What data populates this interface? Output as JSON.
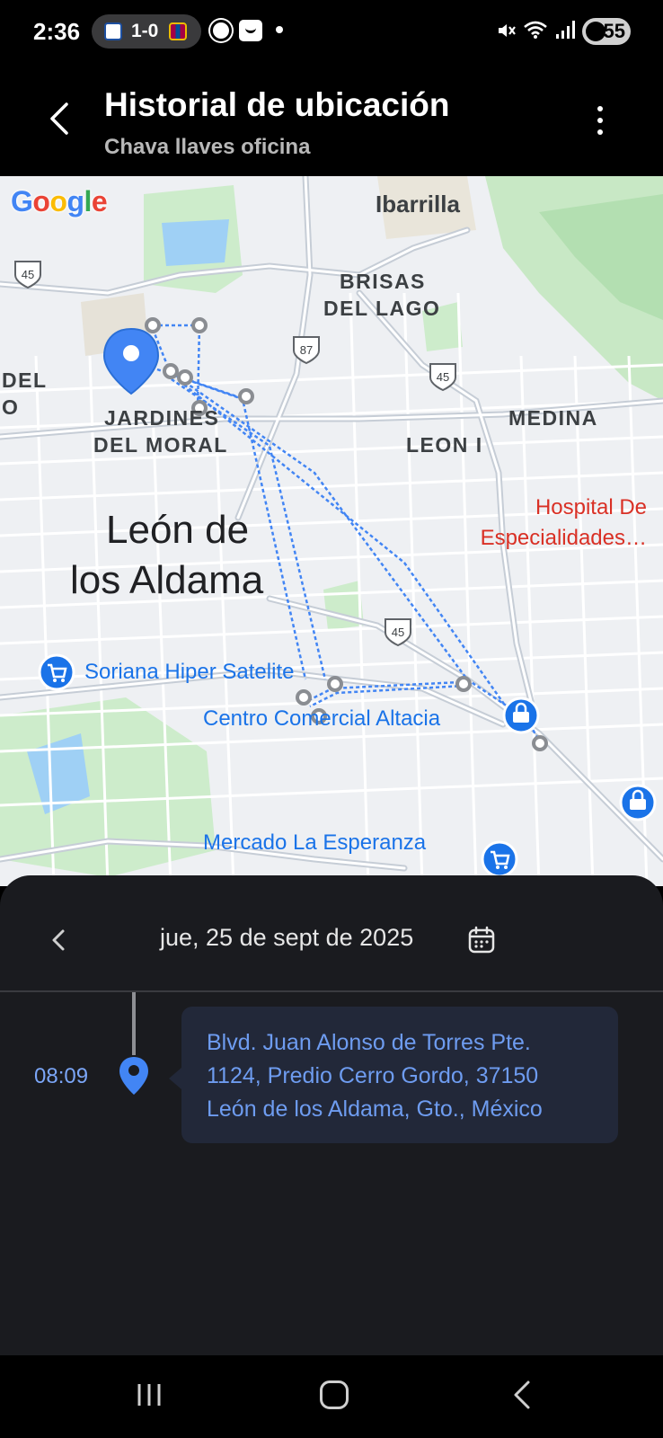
{
  "status_bar": {
    "time": "2:36",
    "score": "1-0",
    "battery": "55"
  },
  "app_bar": {
    "title": "Historial de ubicación",
    "subtitle": "Chava llaves oficina"
  },
  "map": {
    "google_logo": "Google",
    "labels": {
      "ibarrilla": "Ibarrilla",
      "brisas_1": "BRISAS",
      "brisas_2": "DEL LAGO",
      "del_1": "DEL",
      "del_2": "O",
      "jardines_1": "JARDINES",
      "jardines_2": "DEL MORAL",
      "medina": "MEDINA",
      "leon_i": "LEON I",
      "city_1": "León de",
      "city_2": "los Aldama",
      "hospital_1": "Hospital De",
      "hospital_2": "Especialidades…",
      "soriana": "Soriana Hiper Satelite",
      "altacia": "Centro Comercial Altacia",
      "mercado": "Mercado La Esperanza"
    },
    "shields": [
      "45",
      "87",
      "45",
      "45"
    ],
    "colors": {
      "route": "#4285f4",
      "pin": "#4285f4",
      "poi": "#1a73e8",
      "hospital": "#d93025"
    }
  },
  "sheet": {
    "date": "jue, 25 de sept de 2025",
    "entries": [
      {
        "time": "08:09",
        "address_line1": "Blvd. Juan Alonso de Torres Pte.",
        "address_line2": "1124, Predio Cerro Gordo, 37150",
        "address_line3": "León de los Aldama, Gto., México"
      }
    ]
  },
  "icons": {
    "back": "chevron-left-icon",
    "more": "more-vert-icon",
    "calendar": "calendar-icon",
    "pin": "location-pin-icon",
    "shopping": "shopping-cart-icon",
    "shopping_bag": "shopping-bag-icon"
  }
}
